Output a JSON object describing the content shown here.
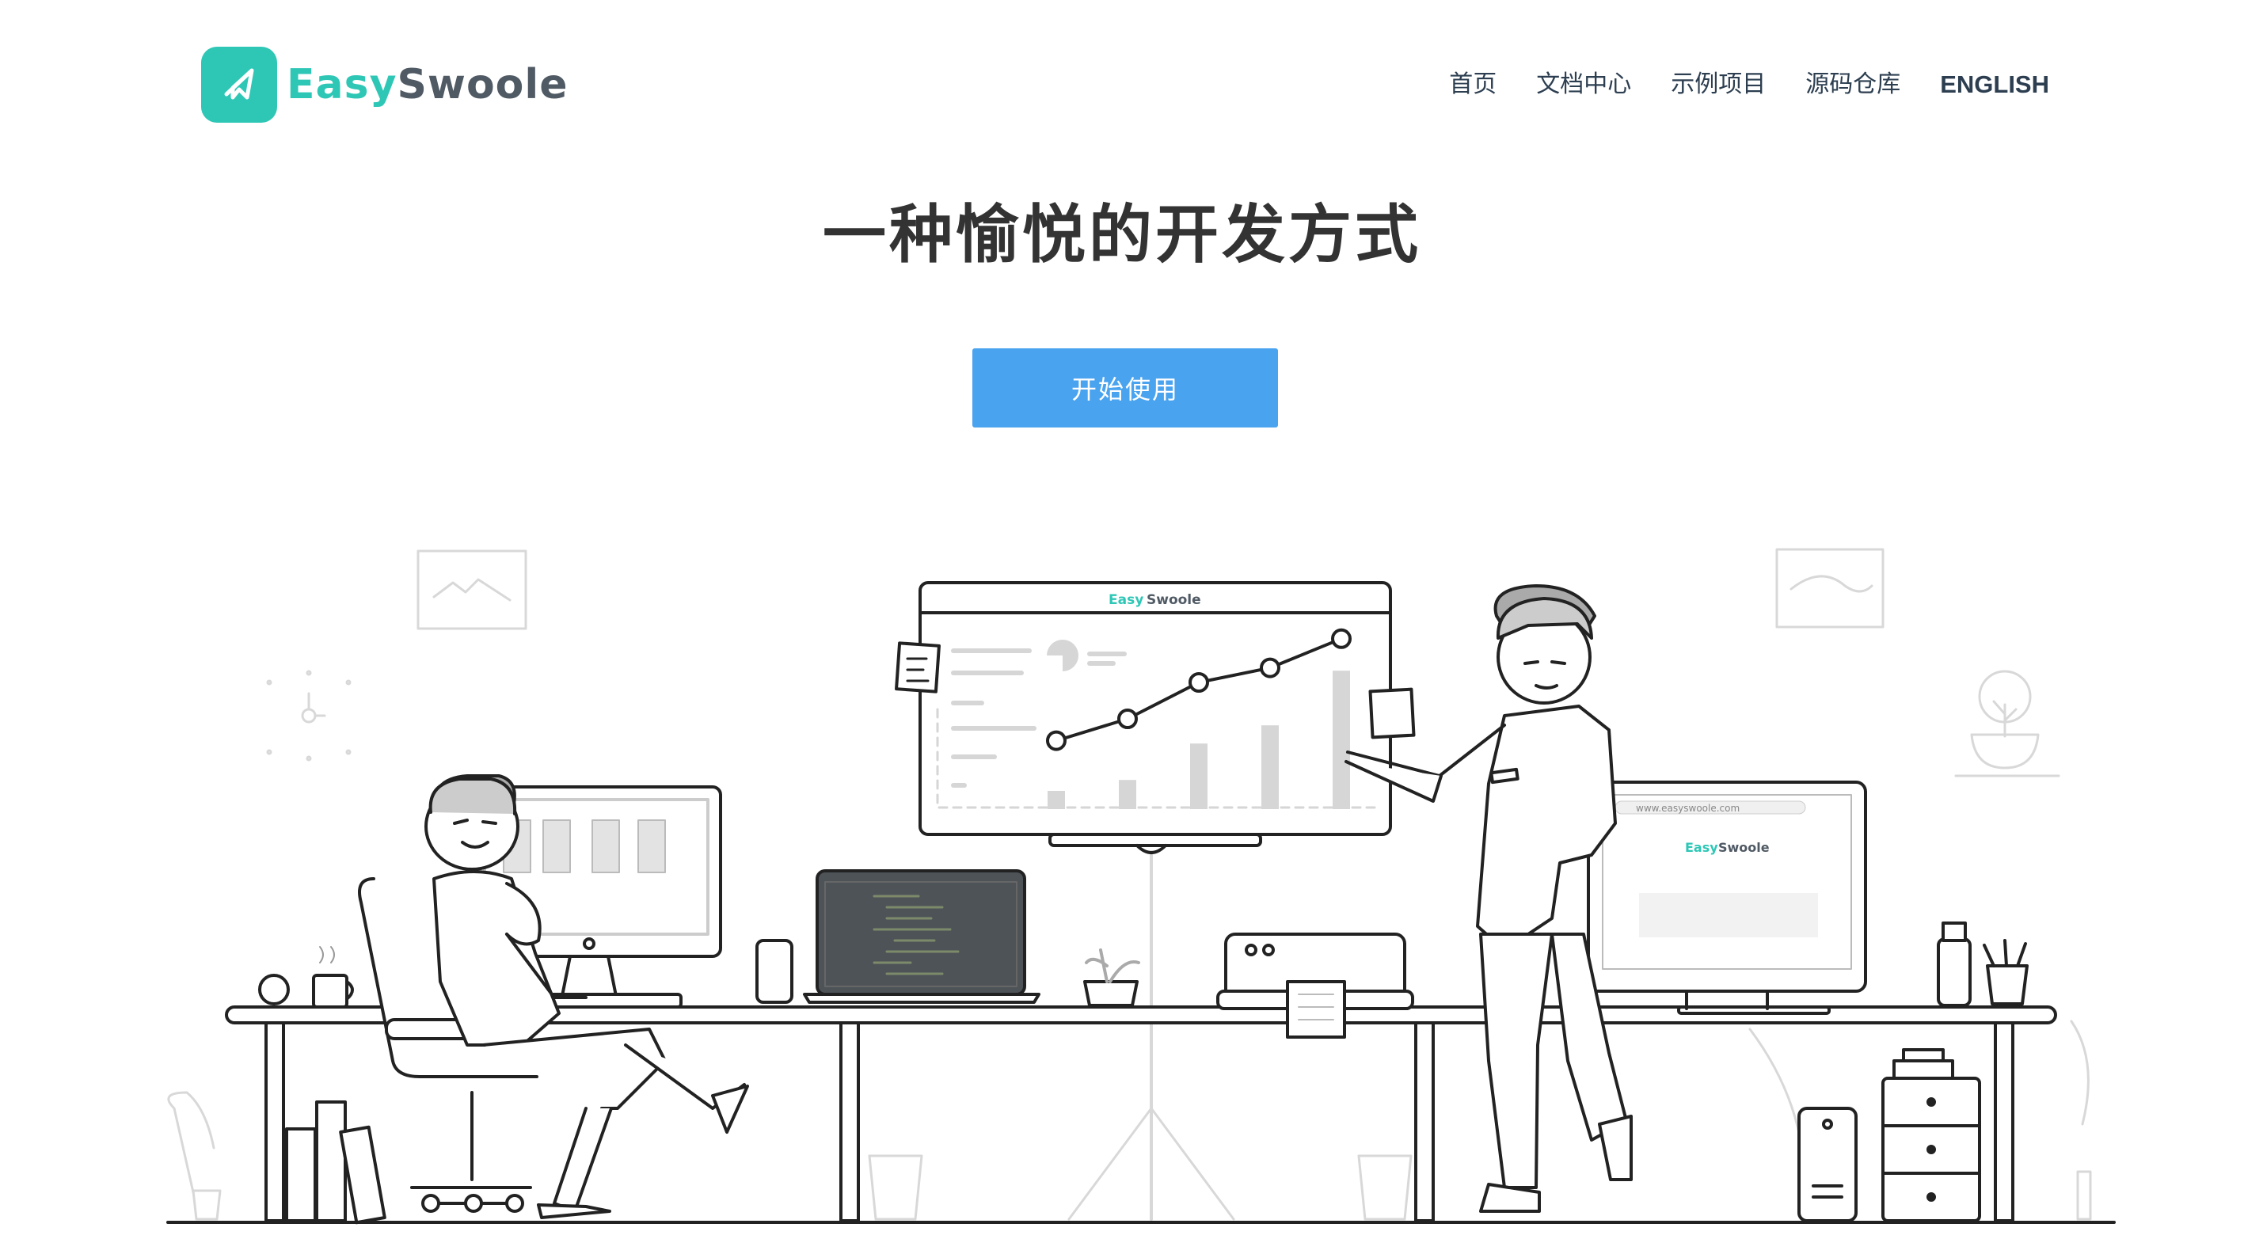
{
  "brand": {
    "logo_part1": "Easy",
    "logo_part2": "Swoole"
  },
  "nav": {
    "items": [
      {
        "label": "首页"
      },
      {
        "label": "文档中心"
      },
      {
        "label": "示例项目"
      },
      {
        "label": "源码仓库"
      },
      {
        "label": "ENGLISH"
      }
    ]
  },
  "hero": {
    "title": "一种愉悦的开发方式",
    "cta_label": "开始使用"
  },
  "illustration": {
    "whiteboard_brand_part1": "Easy",
    "whiteboard_brand_part2": "Swoole",
    "monitor_url": "www.easyswoole.com",
    "monitor_brand_part1": "Easy",
    "monitor_brand_part2": "Swoole",
    "chart_points": [
      0.28,
      0.4,
      0.6,
      0.68,
      0.84
    ],
    "chart_bars": [
      0.1,
      0.16,
      0.36,
      0.46,
      0.76
    ]
  },
  "colors": {
    "accent": "#2ec7b6",
    "button": "#4aa3ef",
    "text": "#333333",
    "line": "#222222"
  }
}
